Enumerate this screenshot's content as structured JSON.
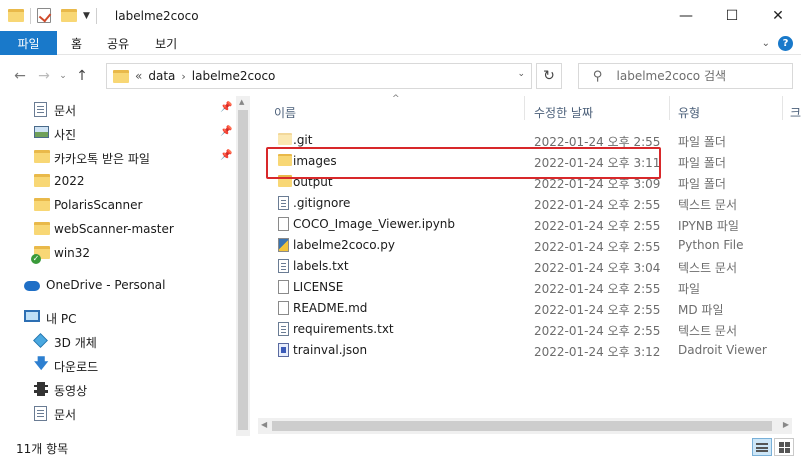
{
  "window": {
    "title": "labelme2coco",
    "minimize": "—",
    "maximize": "☐",
    "close": "✕"
  },
  "ribbon": {
    "tabs": [
      "파일",
      "홈",
      "공유",
      "보기"
    ]
  },
  "address": {
    "overflow": "«",
    "crumbs": [
      "data",
      "labelme2coco"
    ]
  },
  "search": {
    "placeholder": "labelme2coco 검색"
  },
  "nav": {
    "quick_access": [
      {
        "label": "문서",
        "icon": "document-icon",
        "pinned": true
      },
      {
        "label": "사진",
        "icon": "pictures-icon",
        "pinned": true
      },
      {
        "label": "카카오톡 받은 파일",
        "icon": "folder-icon",
        "pinned": true
      },
      {
        "label": "2022",
        "icon": "folder-icon",
        "pinned": false
      },
      {
        "label": "PolarisScanner",
        "icon": "folder-icon",
        "pinned": false
      },
      {
        "label": "webScanner-master",
        "icon": "folder-icon",
        "pinned": false
      },
      {
        "label": "win32",
        "icon": "folder-synced-icon",
        "pinned": false
      }
    ],
    "onedrive": "OneDrive - Personal",
    "this_pc": "내 PC",
    "pc_items": [
      {
        "label": "3D 개체",
        "icon": "3d-objects-icon"
      },
      {
        "label": "다운로드",
        "icon": "downloads-icon"
      },
      {
        "label": "동영상",
        "icon": "videos-icon"
      },
      {
        "label": "문서",
        "icon": "document-icon"
      }
    ]
  },
  "columns": {
    "name": "이름",
    "date": "수정한 날짜",
    "type": "유형",
    "size": "크"
  },
  "files": [
    {
      "name": ".git",
      "date": "2022-01-24 오후 2:55",
      "type": "파일 폴더",
      "icon": "folder-icon"
    },
    {
      "name": "images",
      "date": "2022-01-24 오후 3:11",
      "type": "파일 폴더",
      "icon": "folder-icon"
    },
    {
      "name": "output",
      "date": "2022-01-24 오후 3:09",
      "type": "파일 폴더",
      "icon": "folder-icon"
    },
    {
      "name": ".gitignore",
      "date": "2022-01-24 오후 2:55",
      "type": "텍스트 문서",
      "icon": "text-file-icon"
    },
    {
      "name": "COCO_Image_Viewer.ipynb",
      "date": "2022-01-24 오후 2:55",
      "type": "IPYNB 파일",
      "icon": "file-icon"
    },
    {
      "name": "labelme2coco.py",
      "date": "2022-01-24 오후 2:55",
      "type": "Python File",
      "icon": "python-file-icon"
    },
    {
      "name": "labels.txt",
      "date": "2022-01-24 오후 3:04",
      "type": "텍스트 문서",
      "icon": "text-file-icon"
    },
    {
      "name": "LICENSE",
      "date": "2022-01-24 오후 2:55",
      "type": "파일",
      "icon": "file-icon"
    },
    {
      "name": "README.md",
      "date": "2022-01-24 오후 2:55",
      "type": "MD 파일",
      "icon": "file-icon"
    },
    {
      "name": "requirements.txt",
      "date": "2022-01-24 오후 2:55",
      "type": "텍스트 문서",
      "icon": "text-file-icon"
    },
    {
      "name": "trainval.json",
      "date": "2022-01-24 오후 3:12",
      "type": "Dadroit Viewer",
      "icon": "json-file-icon"
    }
  ],
  "status": {
    "count": "11개 항목"
  },
  "colors": {
    "file_tab": "#1979ca",
    "highlight_box": "#d8282a",
    "folder": "#f8d775"
  }
}
